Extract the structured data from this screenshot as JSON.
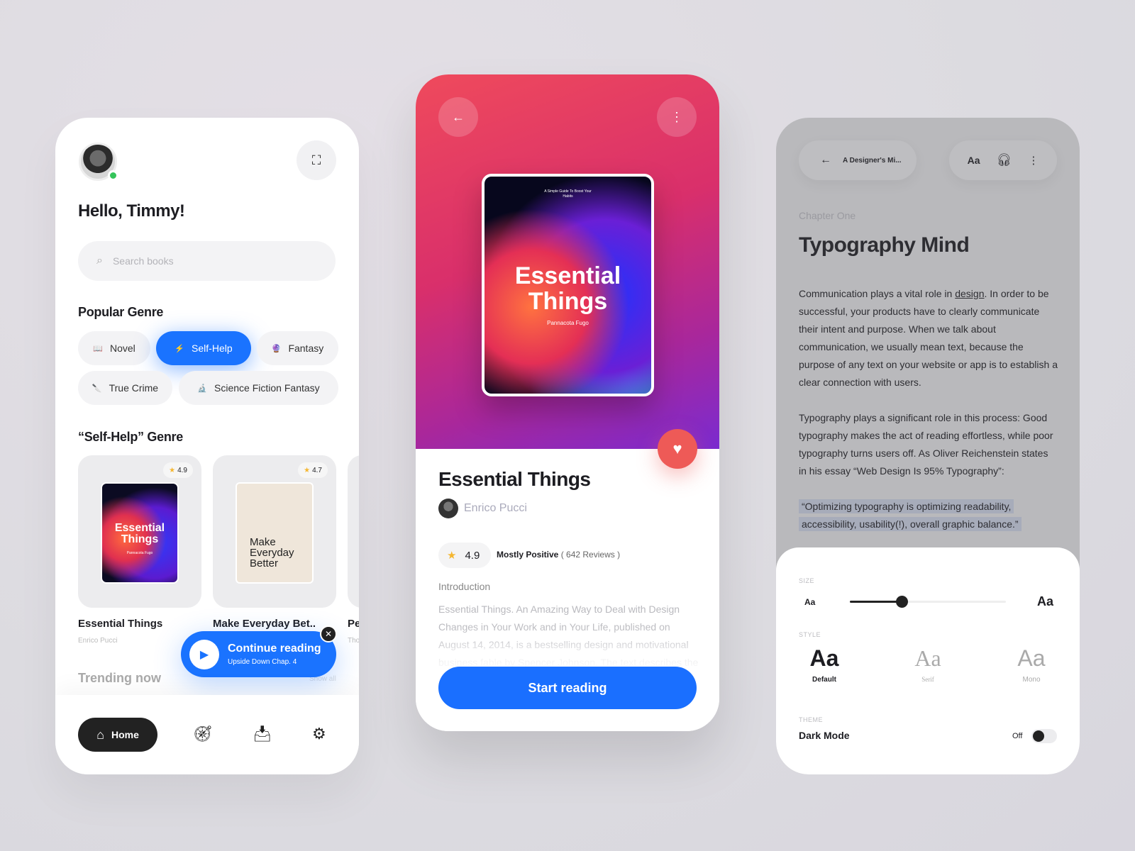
{
  "home": {
    "greeting": "Hello, Timmy!",
    "search_placeholder": "Search books",
    "popular_genre_title": "Popular Genre",
    "genres": [
      {
        "label": "Novel",
        "icon": "📖",
        "active": false
      },
      {
        "label": "Self-Help",
        "icon": "⚡",
        "active": true
      },
      {
        "label": "Fantasy",
        "icon": "🔮",
        "active": false
      },
      {
        "label": "True Crime",
        "icon": "🔪",
        "active": false
      },
      {
        "label": "Science Fiction Fantasy",
        "icon": "🔬",
        "active": false
      }
    ],
    "genre_section_title": "“Self-Help” Genre",
    "books": [
      {
        "title": "Essential Things",
        "author": "Enrico Pucci",
        "rating": "4.9",
        "cover_title": "Essential Things",
        "cover_author": "Pannacota Fugo"
      },
      {
        "title": "Make Everyday Bet..",
        "author": "",
        "rating": "4.7",
        "cover_title": "Make Everyday Better"
      },
      {
        "title": "Pe",
        "author": "Tho"
      }
    ],
    "continue": {
      "title": "Continue reading",
      "subtitle": "Upside Down Chap. 4"
    },
    "trending_title": "Trending now",
    "show_all": "Show all",
    "nav": {
      "home_label": "Home"
    }
  },
  "detail": {
    "cover_tagline": "A Simple Guide To Boost Your Habits",
    "cover_title": "Essential Things",
    "cover_author": "Pannacota Fugo",
    "title": "Essential Things",
    "author": "Enrico Pucci",
    "rating": "4.9",
    "rating_summary": "Mostly Positive",
    "reviews": "( 642 Reviews )",
    "intro_title": "Introduction",
    "intro_text": "Essential Things. An Amazing Way to Deal with Design Changes in Your Work and in Your Life, published on August 14, 2014, is a bestselling design and motivational business fable by Spencer Johnson. The text describes the two “Littlepeople” during their hunt for “cheese”.",
    "start_label": "Start reading"
  },
  "reader": {
    "book_title": "A Designer's Mi...",
    "font_button": "Aa",
    "chapter": "Chapter One",
    "title": "Typography Mind",
    "p1_before": "Communication plays a vital role in ",
    "p1_link": "design",
    "p1_after": ". In order to be successful, your products have to clearly communicate their intent and purpose. When we talk about communication, we usually mean text, because the purpose of any text on your website or app is to establish a clear connection with users.",
    "p2": "Typography plays a significant role in this process: Good typography makes the act of reading effortless, while poor typography turns users off. As Oliver Reichenstein states in his essay “Web Design Is 95% Typography”:",
    "quote": "“Optimizing typography is optimizing readability, accessibility, usability(!), overall graphic balance.”",
    "settings": {
      "size_label": "SIZE",
      "size_small": "Aa",
      "size_large": "Aa",
      "size_value": 0.33,
      "style_label": "STYLE",
      "styles": [
        {
          "sample": "Aa",
          "name": "Default",
          "selected": true
        },
        {
          "sample": "Aa",
          "name": "Serif",
          "selected": false
        },
        {
          "sample": "Aa",
          "name": "Mono",
          "selected": false
        }
      ],
      "theme_label": "THEME",
      "dark_mode_label": "Dark Mode",
      "dark_mode_state": "Off"
    }
  },
  "colors": {
    "accent": "#1a73ff",
    "heart": "#ee5a57",
    "online": "#35c45a"
  }
}
